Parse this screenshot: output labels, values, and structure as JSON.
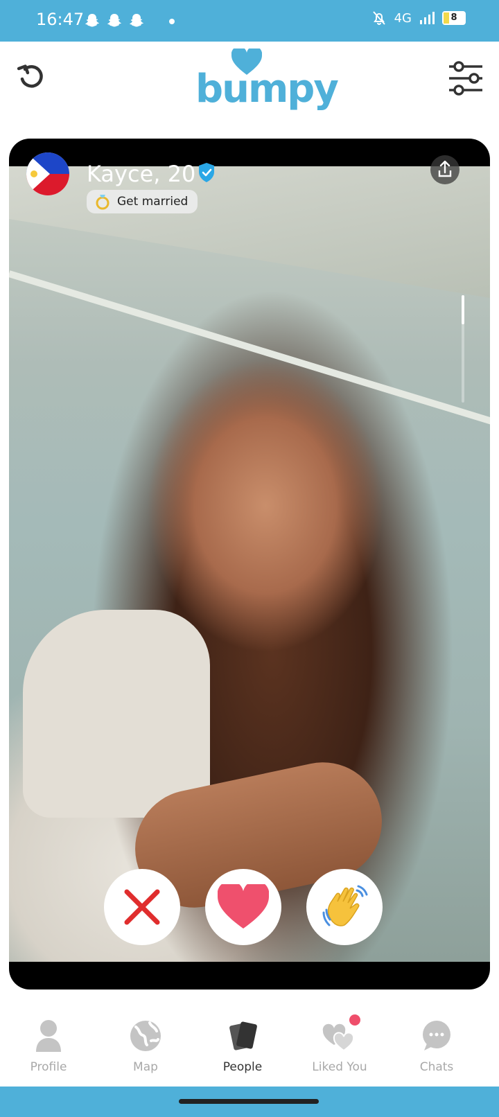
{
  "status_bar": {
    "time": "16:47",
    "network": "4G",
    "battery": "8",
    "icons": [
      "snapchat-icon",
      "snapchat-icon",
      "snapchat-icon",
      "dot-icon",
      "bell-off-icon",
      "signal-icon",
      "battery-icon"
    ]
  },
  "header": {
    "logo_text": "bumpy",
    "undo_icon": "undo-icon",
    "filter_icon": "sliders-icon",
    "brand_color": "#4fb0d9"
  },
  "profile": {
    "name_age": "Kayce, 20",
    "intent": "Get married",
    "country_flag": "philippines-flag-icon",
    "verified": true,
    "share_icon": "share-icon",
    "photo_index": 1,
    "photo_count": 4
  },
  "actions": {
    "dislike_icon": "x-icon",
    "like_icon": "heart-icon",
    "wave_icon": "waving-hand-icon",
    "dislike_color": "#e02d2d",
    "like_color": "#ef506d",
    "wave_color": "#f6c23c"
  },
  "nav": {
    "items": [
      {
        "label": "Profile",
        "icon": "person-icon",
        "active": false
      },
      {
        "label": "Map",
        "icon": "globe-icon",
        "active": false
      },
      {
        "label": "People",
        "icon": "cards-icon",
        "active": true
      },
      {
        "label": "Liked You",
        "icon": "hearts-icon",
        "active": false,
        "badge": true
      },
      {
        "label": "Chats",
        "icon": "chat-bubble-icon",
        "active": false
      }
    ]
  }
}
